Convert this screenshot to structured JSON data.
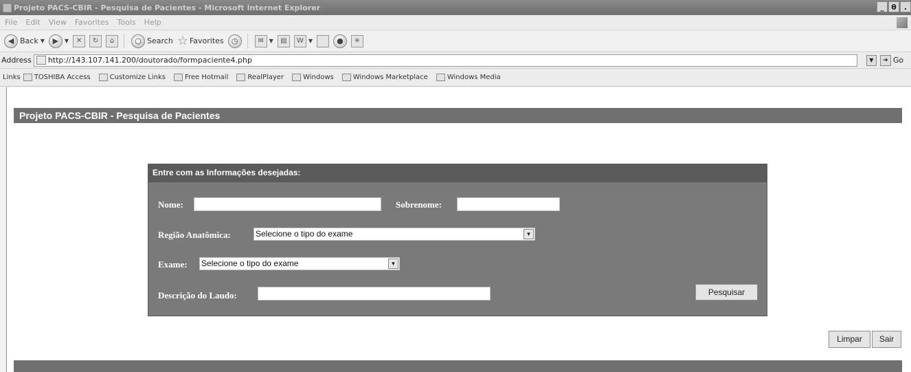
{
  "window": {
    "title": "Projeto PACS-CBIR - Pesquisa de Pacientes - Microsoft Internet Explorer",
    "buttons": [
      "_",
      "θ",
      "."
    ]
  },
  "menu": [
    "File",
    "Edit",
    "View",
    "Favorites",
    "Tools",
    "Help"
  ],
  "toolbar": {
    "back_label": "Back",
    "search_label": "Search",
    "favorites_label": "Favorites"
  },
  "address": {
    "label": "Address",
    "url": "http://143.107.141.200/doutorado/formpaciente4.php",
    "go_label": "Go"
  },
  "links": {
    "label": "Links",
    "items": [
      "TOSHIBA Access",
      "Customize Links",
      "Free Hotmail",
      "RealPlayer",
      "Windows",
      "Windows Marketplace",
      "Windows Media"
    ]
  },
  "page": {
    "header": "Projeto PACS-CBIR - Pesquisa de Pacientes",
    "panel_title": "Entre com as Informações desejadas:",
    "labels": {
      "nome": "Nome:",
      "sobrenome": "Sobrenome:",
      "regiao": "Região Anatômica:",
      "exame": "Exame:",
      "descricao": "Descrição do Laudo:"
    },
    "regiao_selected": "Selecione o tipo do exame",
    "exame_selected": "Selecione o tipo do exame",
    "search_button": "Pesquisar",
    "clear_button": "Limpar",
    "exit_button": "Sair"
  }
}
